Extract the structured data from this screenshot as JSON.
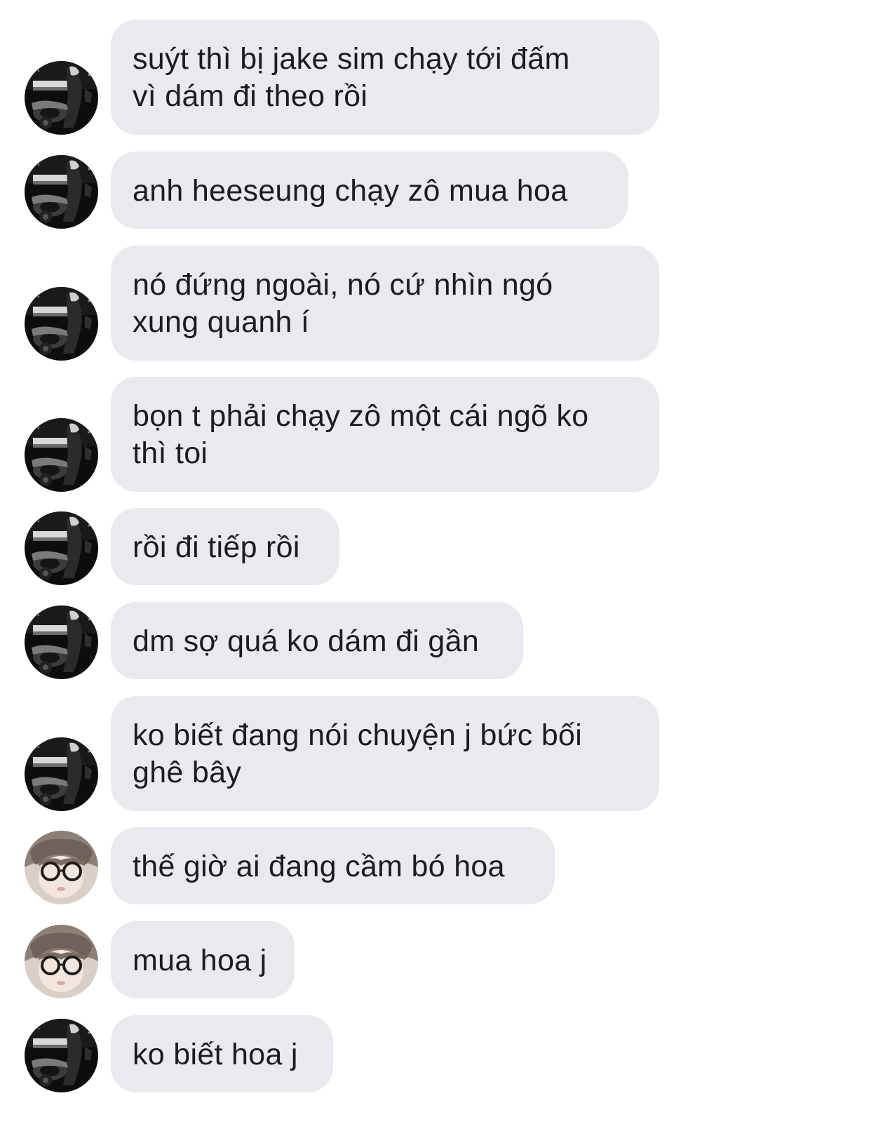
{
  "messages": [
    {
      "sender": "dark-motorbike",
      "text": "suýt thì bị jake sim chạy tới đấm\nvì dám đi theo rồi"
    },
    {
      "sender": "dark-motorbike",
      "text": "anh heeseung chạy zô mua hoa"
    },
    {
      "sender": "dark-motorbike",
      "text": "nó đứng ngoài, nó cứ nhìn ngó\nxung quanh í"
    },
    {
      "sender": "dark-motorbike",
      "text": "bọn t phải chạy zô một cái ngõ ko\nthì toi"
    },
    {
      "sender": "dark-motorbike",
      "text": "rồi đi tiếp rồi"
    },
    {
      "sender": "dark-motorbike",
      "text": "dm sợ quá ko dám đi gần"
    },
    {
      "sender": "dark-motorbike",
      "text": "ko biết đang nói chuyện j bức bối\nghê bây"
    },
    {
      "sender": "glasses",
      "text": "thế giờ ai đang cầm bó hoa"
    },
    {
      "sender": "glasses",
      "text": "mua hoa j"
    },
    {
      "sender": "dark-motorbike",
      "text": "ko biết hoa j"
    }
  ],
  "colors": {
    "bubble_background": "#e9e9ee",
    "text": "#1c1c1e",
    "page_background": "#ffffff"
  },
  "icons": {
    "dark-motorbike": "avatar-motorbike-icon",
    "glasses": "avatar-glasses-icon"
  }
}
